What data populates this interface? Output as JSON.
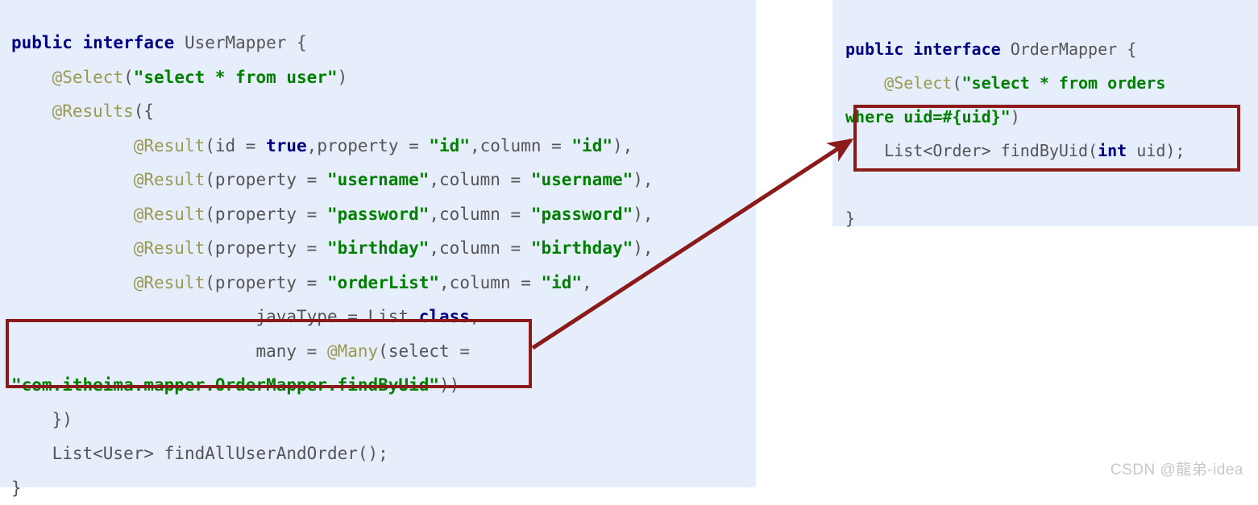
{
  "left_panel": {
    "name": "UserMapper interface source",
    "background": "#e6edfb",
    "lines": [
      {
        "indent": 0,
        "tokens": [
          {
            "t": "public interface ",
            "c": "kw"
          },
          {
            "t": "UserMapper {",
            "c": "pln"
          }
        ]
      },
      {
        "indent": 1,
        "tokens": [
          {
            "t": "@Select",
            "c": "ann"
          },
          {
            "t": "(",
            "c": "pln"
          },
          {
            "t": "\"select * from user\"",
            "c": "str"
          },
          {
            "t": ")",
            "c": "pln"
          }
        ]
      },
      {
        "indent": 1,
        "tokens": [
          {
            "t": "@Results",
            "c": "ann"
          },
          {
            "t": "({",
            "c": "pln"
          }
        ]
      },
      {
        "indent": 3,
        "tokens": [
          {
            "t": "@Result",
            "c": "ann"
          },
          {
            "t": "(id = ",
            "c": "pln"
          },
          {
            "t": "true",
            "c": "kw"
          },
          {
            "t": ",property = ",
            "c": "pln"
          },
          {
            "t": "\"id\"",
            "c": "str"
          },
          {
            "t": ",column = ",
            "c": "pln"
          },
          {
            "t": "\"id\"",
            "c": "str"
          },
          {
            "t": "),",
            "c": "pln"
          }
        ]
      },
      {
        "indent": 3,
        "tokens": [
          {
            "t": "@Result",
            "c": "ann"
          },
          {
            "t": "(property = ",
            "c": "pln"
          },
          {
            "t": "\"username\"",
            "c": "str"
          },
          {
            "t": ",column = ",
            "c": "pln"
          },
          {
            "t": "\"username\"",
            "c": "str"
          },
          {
            "t": "),",
            "c": "pln"
          }
        ]
      },
      {
        "indent": 3,
        "tokens": [
          {
            "t": "@Result",
            "c": "ann"
          },
          {
            "t": "(property = ",
            "c": "pln"
          },
          {
            "t": "\"password\"",
            "c": "str"
          },
          {
            "t": ",column = ",
            "c": "pln"
          },
          {
            "t": "\"password\"",
            "c": "str"
          },
          {
            "t": "),",
            "c": "pln"
          }
        ]
      },
      {
        "indent": 3,
        "tokens": [
          {
            "t": "@Result",
            "c": "ann"
          },
          {
            "t": "(property = ",
            "c": "pln"
          },
          {
            "t": "\"birthday\"",
            "c": "str"
          },
          {
            "t": ",column = ",
            "c": "pln"
          },
          {
            "t": "\"birthday\"",
            "c": "str"
          },
          {
            "t": "),",
            "c": "pln"
          }
        ]
      },
      {
        "indent": 3,
        "tokens": [
          {
            "t": "@Result",
            "c": "ann"
          },
          {
            "t": "(property = ",
            "c": "pln"
          },
          {
            "t": "\"orderList\"",
            "c": "str"
          },
          {
            "t": ",column = ",
            "c": "pln"
          },
          {
            "t": "\"id\"",
            "c": "str"
          },
          {
            "t": ",",
            "c": "pln"
          }
        ]
      },
      {
        "indent": 6,
        "tokens": [
          {
            "t": "javaType = List.",
            "c": "pln"
          },
          {
            "t": "class",
            "c": "kw"
          },
          {
            "t": ",",
            "c": "pln"
          }
        ]
      },
      {
        "indent": 6,
        "tokens": [
          {
            "t": "many = ",
            "c": "pln"
          },
          {
            "t": "@Many",
            "c": "ann"
          },
          {
            "t": "(select =",
            "c": "pln"
          }
        ]
      },
      {
        "indent": 0,
        "tokens": [
          {
            "t": "\"com.itheima.mapper.OrderMapper.findByUid\"",
            "c": "str"
          },
          {
            "t": "))",
            "c": "pln"
          }
        ]
      },
      {
        "indent": 1,
        "tokens": [
          {
            "t": "})",
            "c": "pln"
          }
        ]
      },
      {
        "indent": 1,
        "tokens": [
          {
            "t": "List<User> findAllUserAndOrder();",
            "c": "pln"
          }
        ]
      },
      {
        "indent": 0,
        "tokens": [
          {
            "t": "}",
            "c": "pln"
          }
        ]
      }
    ]
  },
  "right_panel": {
    "name": "OrderMapper interface source",
    "background": "#e6edfb",
    "lines": [
      {
        "indent": 0,
        "tokens": [
          {
            "t": "public interface ",
            "c": "kw"
          },
          {
            "t": "OrderMapper {",
            "c": "pln"
          }
        ]
      },
      {
        "indent": 1,
        "tokens": [
          {
            "t": "@Select",
            "c": "ann"
          },
          {
            "t": "(",
            "c": "pln"
          },
          {
            "t": "\"select * from orders",
            "c": "str"
          }
        ]
      },
      {
        "indent": 0,
        "tokens": [
          {
            "t": "where uid=#{uid}\"",
            "c": "str"
          },
          {
            "t": ")",
            "c": "pln"
          }
        ]
      },
      {
        "indent": 1,
        "tokens": [
          {
            "t": "List<Order> findByUid(",
            "c": "pln"
          },
          {
            "t": "int",
            "c": "kw"
          },
          {
            "t": " uid);",
            "c": "pln"
          }
        ]
      },
      {
        "indent": 0,
        "tokens": [
          {
            "t": "",
            "c": "pln"
          }
        ]
      },
      {
        "indent": 0,
        "tokens": [
          {
            "t": "}",
            "c": "pln"
          }
        ]
      }
    ]
  },
  "annotations": {
    "highlight_color": "#8b1a1a",
    "left_box_label": "many = @Many(select = \"com.itheima.mapper.OrderMapper.findByUid\"))",
    "right_box_label": "List<Order> findByUid(int uid);",
    "arrow_label": "reference-arrow-from-many-select-to-findByUid"
  },
  "watermark": {
    "text": "CSDN @龍弟-idea"
  }
}
